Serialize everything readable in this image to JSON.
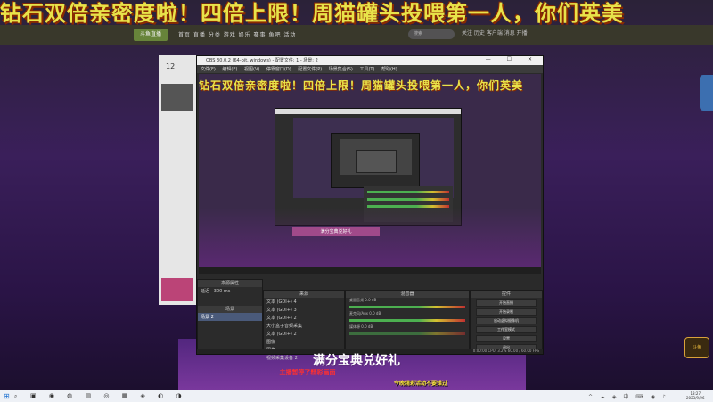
{
  "banner": {
    "text": "钻石双倍亲密度啦！四倍上限！周猫罐头投喂第一人，你们英美"
  },
  "banner_inner": {
    "text": "钻石双倍亲密度啦！四倍上限！周猫罐头投喂第一人，你们英美"
  },
  "site": {
    "logo": "斗鱼直播",
    "nav": "首页  直播  分类  游戏  娱乐  赛事  鱼吧  活动",
    "search_placeholder": "搜索",
    "icons": "关注  历史  客户端  消息  开播"
  },
  "left_panel": {
    "count": "12"
  },
  "obs": {
    "title": "OBS 30.0.2 (64-bit, windows) - 配置文件: 1 - 场景: 2",
    "window_controls": "— ☐ ✕",
    "menu": "文件(F) 编辑(E) 视图(V) 停靠窗口(D) 配置文件(P) 场景集合(S) 工具(T) 帮助(H)",
    "preview_box": "满分宝典兑好礼",
    "scenes_header": "场景",
    "scene_selected": "场景 2",
    "properties_header": "来源属性",
    "source_label": "延迟",
    "source_value": "300 ms",
    "sources_header": "来源",
    "sources": [
      "文本 (GDI+) 4",
      "文本 (GDI+) 3",
      "文本 (GDI+) 2",
      "大小盒子音频采集",
      "文本 (GDI+) 2",
      "图像",
      "图像",
      "视频采集设备 2"
    ],
    "mixer_header": "混音器",
    "mixer_tracks": [
      "桌面音频",
      "麦克风/Aux",
      "媒体源"
    ],
    "mixer_db": [
      "0.0 dB",
      "0.0 dB",
      "0.0 dB"
    ],
    "controls_header": "控件",
    "controls": [
      "开始直播",
      "开始录制",
      "启动虚拟摄像机",
      "工作室模式",
      "设置",
      "退出"
    ],
    "status": "0:00:00  CPU: 3.2%  60.00 / 60.00 FPS"
  },
  "gift_banner": "满分宝典兑好礼",
  "red_note": "主播暂停了精彩画面",
  "yellow_note": "今晚精彩活动不要错过",
  "corner_badge": "斗鱼",
  "taskbar": {
    "start": "⊞",
    "search": "⌕",
    "apps": "▣ ◉ ◍ ▤ ◎ ▦ ◈ ◐ ◑",
    "tray": "^ ☁ ◈ 中 ⌨ ◉ ♪",
    "time": "18:27",
    "date": "2023/9/26"
  }
}
